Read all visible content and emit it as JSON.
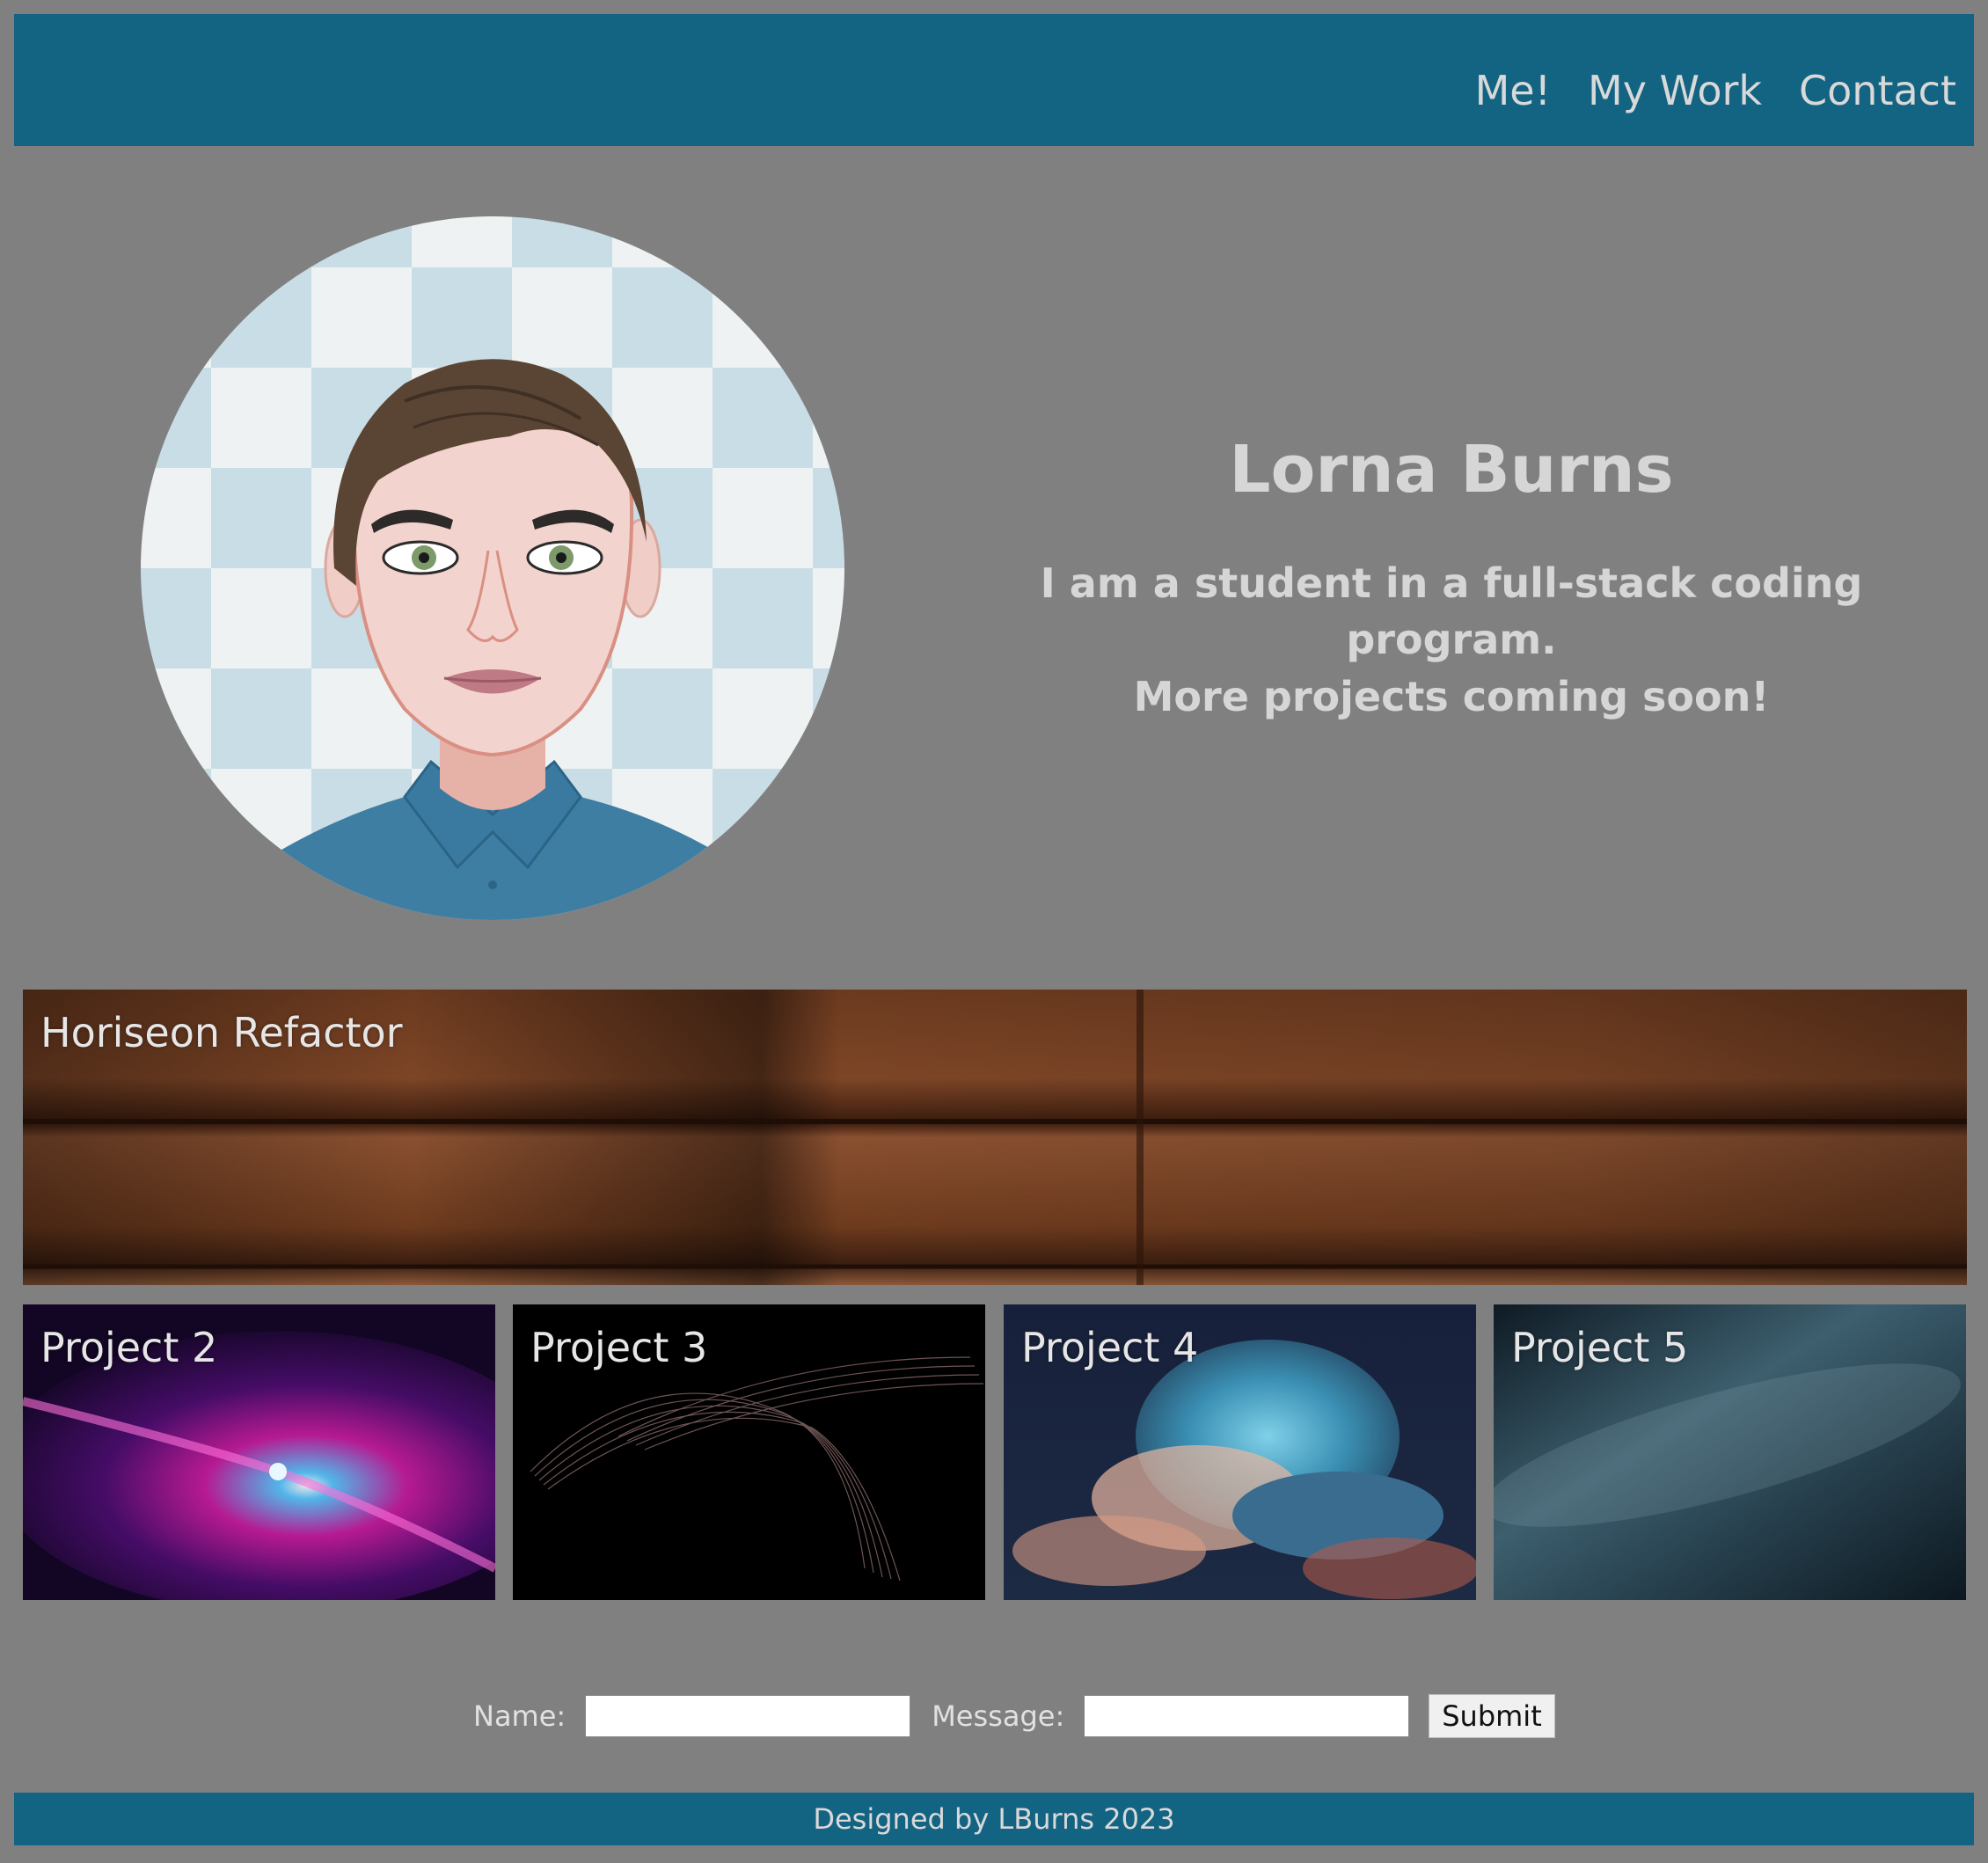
{
  "colors": {
    "page_background": "#808080",
    "header_background": "#136382",
    "footer_background": "#136382",
    "text_light": "#d6d6d6"
  },
  "nav": {
    "items": [
      {
        "label": "Me!"
      },
      {
        "label": "My Work"
      },
      {
        "label": "Contact"
      }
    ]
  },
  "hero": {
    "name": "Lorna Burns",
    "subtitle_line1": "I am a student in a full-stack coding program.",
    "subtitle_line2": "More projects coming soon!"
  },
  "projects": [
    {
      "title": "Horiseon Refactor"
    },
    {
      "title": "Project 2"
    },
    {
      "title": "Project 3"
    },
    {
      "title": "Project 4"
    },
    {
      "title": "Project 5"
    }
  ],
  "contact_form": {
    "name_label": "Name:",
    "name_value": "",
    "message_label": "Message:",
    "message_value": "",
    "submit_label": "Submit"
  },
  "footer": {
    "text": "Designed by LBurns 2023"
  }
}
